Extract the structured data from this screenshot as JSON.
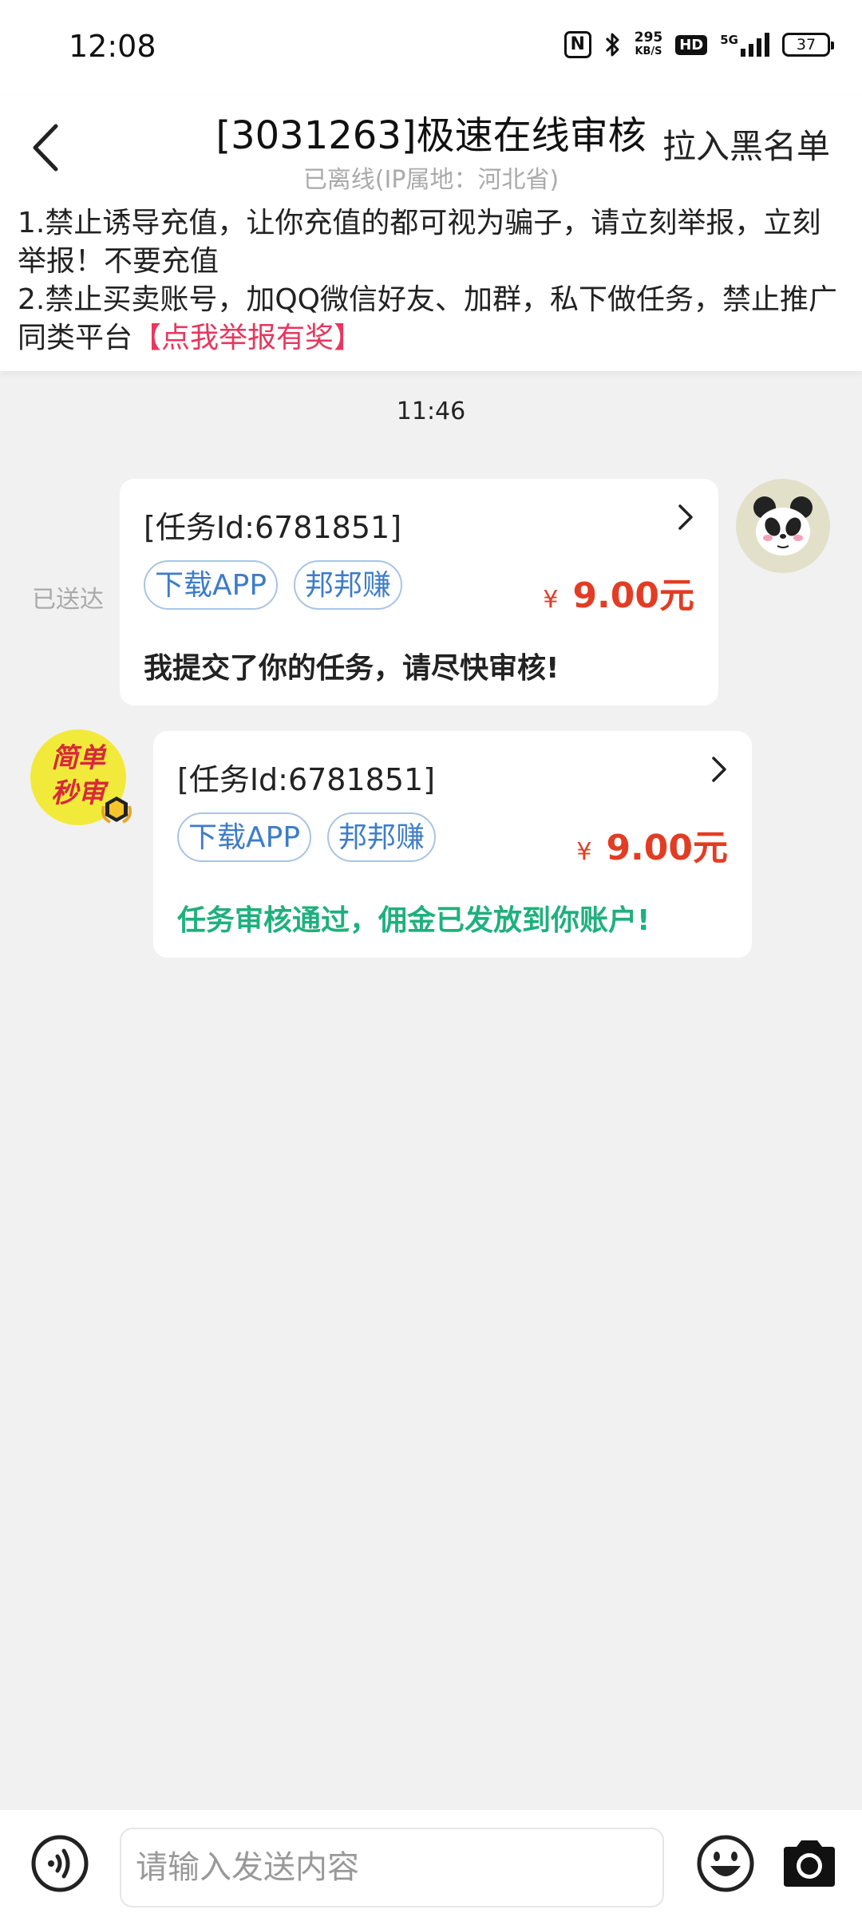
{
  "status_bar": {
    "time": "12:08",
    "nfc": "N",
    "net_speed_value": "295",
    "net_speed_unit": "KB/S",
    "hd": "HD",
    "network": "5G",
    "battery": "37"
  },
  "header": {
    "title": "[3031263]极速在线审核",
    "subtitle": "已离线(IP属地：河北省)",
    "blacklist_label": "拉入黑名单",
    "back_icon": "chevron-left-icon"
  },
  "notice": {
    "line1": "1.禁止诱导充值，让你充值的都可视为骗子，请立刻举报，立刻举报！不要充值",
    "line2": "2.禁止买卖账号，加QQ微信好友、加群，私下做任务，禁止推广同类平台",
    "report_link": "【点我举报有奖】",
    "report_link_color": "#e8365d"
  },
  "conversation": {
    "timestamp": "11:46",
    "messages": [
      {
        "direction": "sent",
        "status": "已送达",
        "task_id": "[任务Id:6781851]",
        "tags": [
          "下载APP",
          "邦邦赚"
        ],
        "currency": "¥",
        "amount": "9.00元",
        "text": "我提交了你的任务，请尽快审核!",
        "avatar_icon": "panda-avatar-icon"
      },
      {
        "direction": "received",
        "task_id": "[任务Id:6781851]",
        "tags": [
          "下载APP",
          "邦邦赚"
        ],
        "currency": "¥",
        "amount": "9.00元",
        "text": "任务审核通过，佣金已发放到你账户!",
        "text_color": "#1fb07d",
        "avatar_text_1": "简单",
        "avatar_text_2": "秒审",
        "avatar_icon": "shop-avatar-icon"
      }
    ]
  },
  "input_bar": {
    "placeholder": "请输入发送内容",
    "voice_icon": "voice-icon",
    "emoji_icon": "emoji-icon",
    "camera_icon": "camera-icon"
  },
  "colors": {
    "price": "#e23d24",
    "tag_text": "#3d7cc9",
    "background": "#f2f1f2"
  }
}
